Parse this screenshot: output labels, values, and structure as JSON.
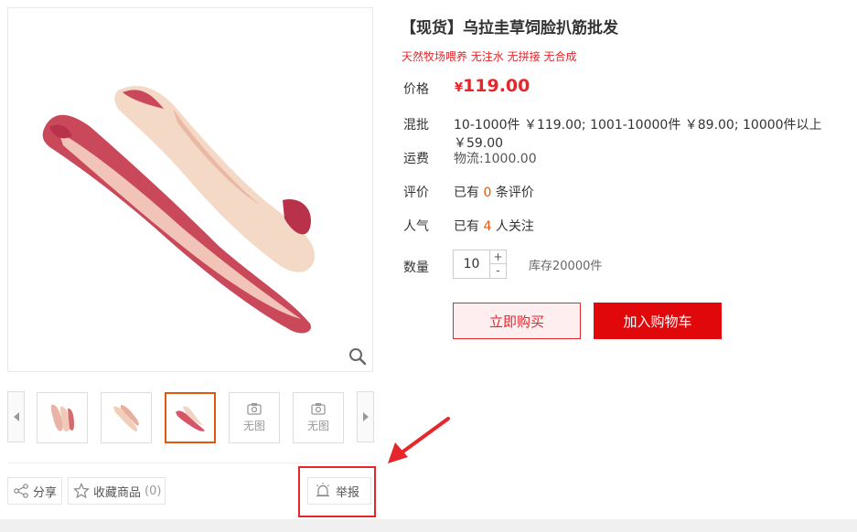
{
  "product": {
    "title": "【现货】乌拉圭草饲脸扒筋批发",
    "subtitle": "天然牧场喂养 无注水 无拼接 无合成"
  },
  "price": {
    "label": "价格",
    "currency": "¥",
    "amount": "119.00"
  },
  "wholesale": {
    "label": "混批",
    "value": "10-1000件 ￥119.00; 1001-10000件 ￥89.00; 10000件以上 ￥59.00"
  },
  "shipping": {
    "label": "运费",
    "value": "物流:1000.00"
  },
  "reviews": {
    "label": "评价",
    "prefix": "已有",
    "count": "0",
    "suffix": "条评价"
  },
  "popularity": {
    "label": "人气",
    "prefix": "已有",
    "count": "4",
    "suffix": "人关注"
  },
  "quantity": {
    "label": "数量",
    "value": "10",
    "plus": "+",
    "minus": "-",
    "stock": "库存20000件"
  },
  "buttons": {
    "buy_now": "立即购买",
    "add_to_cart": "加入购物车"
  },
  "gallery": {
    "no_image_label": "无图",
    "no_image_label_2": "无图"
  },
  "actions": {
    "share": "分享",
    "favorite": "收藏商品",
    "favorite_count": "(0)",
    "report": "举报"
  },
  "colors": {
    "accent_red": "#e5262b",
    "orange": "#e4570a",
    "cart_red": "#e0080b"
  },
  "icons": [
    "zoom-icon",
    "share-icon",
    "star-icon",
    "bell-icon",
    "camera-icon",
    "chevron-left-icon",
    "chevron-right-icon"
  ]
}
